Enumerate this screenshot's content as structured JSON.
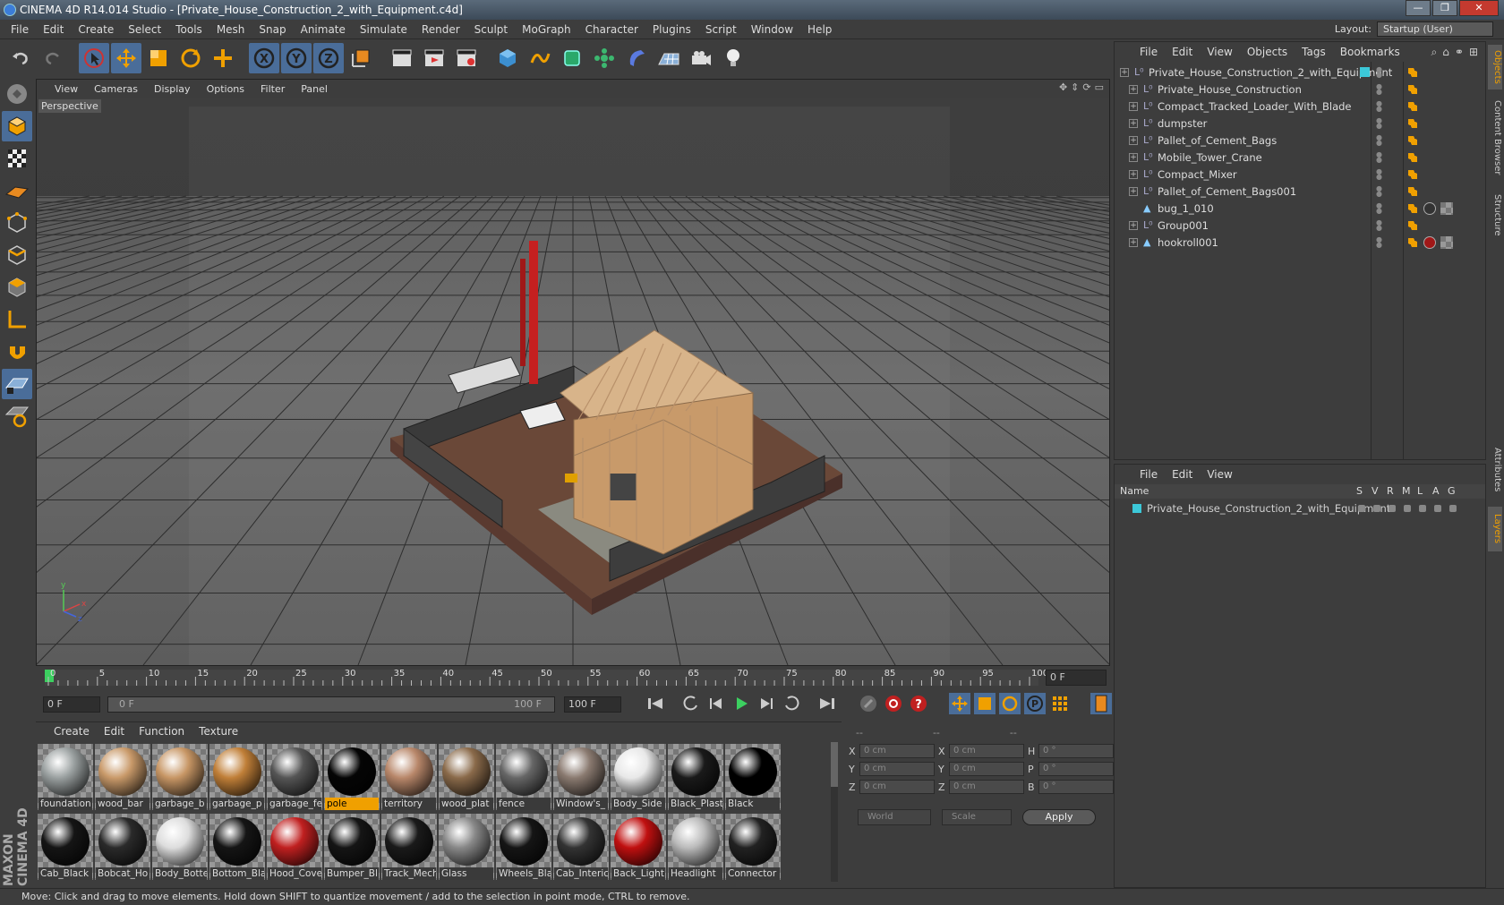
{
  "window": {
    "title": "CINEMA 4D R14.014 Studio - [Private_House_Construction_2_with_Equipment.c4d]"
  },
  "menu": [
    "File",
    "Edit",
    "Create",
    "Select",
    "Tools",
    "Mesh",
    "Snap",
    "Animate",
    "Simulate",
    "Render",
    "Sculpt",
    "MoGraph",
    "Character",
    "Plugins",
    "Script",
    "Window",
    "Help"
  ],
  "layout": {
    "label": "Layout:",
    "value": "Startup (User)"
  },
  "viewport": {
    "menu": [
      "View",
      "Cameras",
      "Display",
      "Options",
      "Filter",
      "Panel"
    ],
    "label": "Perspective"
  },
  "timeline": {
    "ticks": [
      "0",
      "5",
      "10",
      "15",
      "20",
      "25",
      "30",
      "35",
      "40",
      "45",
      "50",
      "55",
      "60",
      "65",
      "70",
      "75",
      "80",
      "85",
      "90",
      "95",
      "100"
    ],
    "current_frame": "0 F",
    "start_field": "0 F",
    "range_start": "0 F",
    "range_end": "100 F",
    "end_field": "100 F"
  },
  "materials": {
    "menu": [
      "Create",
      "Edit",
      "Function",
      "Texture"
    ],
    "row1": [
      {
        "name": "foundation",
        "color": "#9aa0a0"
      },
      {
        "name": "wood_bar",
        "color": "#c99a6a"
      },
      {
        "name": "garbage_b",
        "color": "#c79665"
      },
      {
        "name": "garbage_p",
        "color": "#c07f38"
      },
      {
        "name": "garbage_fe",
        "color": "#555555"
      },
      {
        "name": "pole",
        "color": "#050505"
      },
      {
        "name": "territory",
        "color": "#b8876a"
      },
      {
        "name": "wood_plat",
        "color": "#8a6a4a"
      },
      {
        "name": "fence",
        "color": "#666666"
      },
      {
        "name": "Window's_",
        "color": "#8a7a70"
      },
      {
        "name": "Body_Side",
        "color": "#e8e8e8"
      },
      {
        "name": "Black_Plast",
        "color": "#1a1a1a"
      },
      {
        "name": "Black",
        "color": "#000000"
      }
    ],
    "row2": [
      {
        "name": "Cab_Black",
        "color": "#151515"
      },
      {
        "name": "Bobcat_Ho",
        "color": "#2a2a2a"
      },
      {
        "name": "Body_Botte",
        "color": "#dddddd"
      },
      {
        "name": "Bottom_Bla",
        "color": "#151515"
      },
      {
        "name": "Hood_Cove",
        "color": "#c02020"
      },
      {
        "name": "Bumper_Bl",
        "color": "#151515"
      },
      {
        "name": "Track_Mech",
        "color": "#1a1a1a"
      },
      {
        "name": "Glass",
        "color": "#888888"
      },
      {
        "name": "Wheels_Bla",
        "color": "#151515"
      },
      {
        "name": "Cab_Interic",
        "color": "#333333"
      },
      {
        "name": "Back_Light",
        "color": "#c01010"
      },
      {
        "name": "Headlight",
        "color": "#bbbbbb"
      },
      {
        "name": "Connector",
        "color": "#222222"
      }
    ],
    "selected": "pole"
  },
  "coords": {
    "rows": [
      {
        "a": "X",
        "av": "0 cm",
        "b": "X",
        "bv": "0 cm",
        "c": "H",
        "cv": "0 °"
      },
      {
        "a": "Y",
        "av": "0 cm",
        "b": "Y",
        "bv": "0 cm",
        "c": "P",
        "cv": "0 °"
      },
      {
        "a": "Z",
        "av": "0 cm",
        "b": "Z",
        "bv": "0 cm",
        "c": "B",
        "cv": "0 °"
      }
    ],
    "header": [
      "--",
      "--",
      "--"
    ],
    "world": "World",
    "scale": "Scale",
    "apply": "Apply"
  },
  "objects": {
    "menu": [
      "File",
      "Edit",
      "View",
      "Objects",
      "Tags",
      "Bookmarks"
    ],
    "items": [
      {
        "name": "Private_House_Construction_2_with_Equipment",
        "type": "null",
        "level": 0
      },
      {
        "name": "Private_House_Construction",
        "type": "null",
        "level": 1
      },
      {
        "name": "Compact_Tracked_Loader_With_Blade",
        "type": "null",
        "level": 1
      },
      {
        "name": "dumpster",
        "type": "null",
        "level": 1
      },
      {
        "name": "Pallet_of_Cement_Bags",
        "type": "null",
        "level": 1
      },
      {
        "name": "Mobile_Tower_Crane",
        "type": "null",
        "level": 1
      },
      {
        "name": "Compact_Mixer",
        "type": "null",
        "level": 1
      },
      {
        "name": "Pallet_of_Cement_Bags001",
        "type": "null",
        "level": 1
      },
      {
        "name": "bug_1_010",
        "type": "poly",
        "level": 1
      },
      {
        "name": "Group001",
        "type": "null",
        "level": 1
      },
      {
        "name": "hookroll001",
        "type": "poly",
        "level": 1
      }
    ]
  },
  "layers": {
    "menu": [
      "File",
      "Edit",
      "View"
    ],
    "columns": [
      "Name",
      "S",
      "V",
      "R",
      "M",
      "L",
      "A",
      "G"
    ],
    "items": [
      "Private_House_Construction_2_with_Equipment"
    ]
  },
  "right_tabs": [
    "Objects",
    "Content Browser",
    "Structure",
    "Attributes",
    "Layers"
  ],
  "brand": "MAXON CINEMA 4D",
  "status": "Move: Click and drag to move elements. Hold down SHIFT to quantize movement / add to the selection in point mode, CTRL to remove.",
  "colors": {
    "accent": "#4a6d99",
    "selection": "#f0a000",
    "teal": "#3cc8d8"
  }
}
